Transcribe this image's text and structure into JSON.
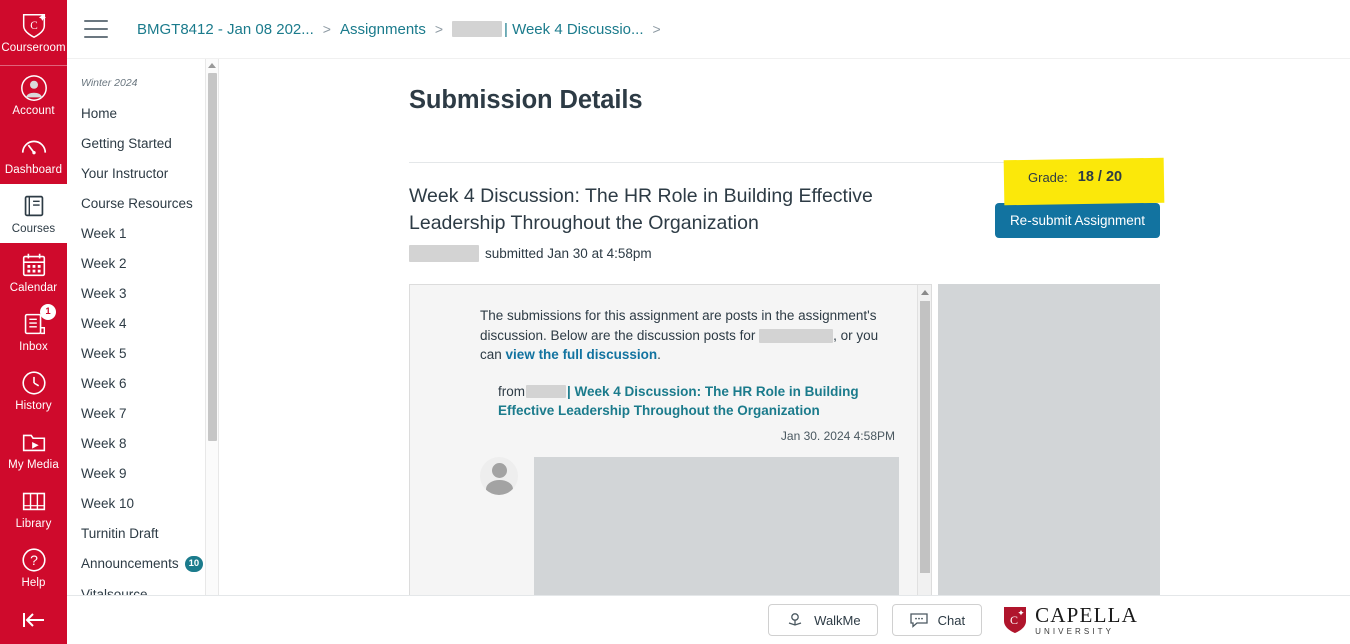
{
  "rail": {
    "brand": {
      "label": "Courseroom",
      "icon": "capella-shield-icon"
    },
    "items": [
      {
        "label": "Account",
        "icon": "account-avatar-icon",
        "active": false,
        "badge": null
      },
      {
        "label": "Dashboard",
        "icon": "dashboard-gauge-icon",
        "active": false,
        "badge": null
      },
      {
        "label": "Courses",
        "icon": "courses-book-icon",
        "active": true,
        "badge": null
      },
      {
        "label": "Calendar",
        "icon": "calendar-icon",
        "active": false,
        "badge": null
      },
      {
        "label": "Inbox",
        "icon": "inbox-icon",
        "active": false,
        "badge": "1"
      },
      {
        "label": "History",
        "icon": "history-clock-icon",
        "active": false,
        "badge": null
      },
      {
        "label": "My Media",
        "icon": "my-media-play-folder-icon",
        "active": false,
        "badge": null
      },
      {
        "label": "Library",
        "icon": "library-books-icon",
        "active": false,
        "badge": null
      },
      {
        "label": "Help",
        "icon": "help-question-icon",
        "active": false,
        "badge": null
      }
    ],
    "collapse_icon": "collapse-left-arrow-icon"
  },
  "breadcrumb": {
    "menu_icon": "hamburger-menu-icon",
    "items": [
      {
        "label": "BMGT8412 - Jan 08 202...",
        "type": "link"
      },
      {
        "label": "Assignments",
        "type": "link"
      },
      {
        "label": "| Week 4 Discussio...",
        "type": "link",
        "redacted_prefix": true
      }
    ],
    "separator": ">"
  },
  "course_nav": {
    "term": "Winter 2024",
    "items": [
      {
        "label": "Home",
        "badge": null
      },
      {
        "label": "Getting Started",
        "badge": null
      },
      {
        "label": "Your Instructor",
        "badge": null
      },
      {
        "label": "Course Resources",
        "badge": null
      },
      {
        "label": "Week 1",
        "badge": null
      },
      {
        "label": "Week 2",
        "badge": null
      },
      {
        "label": "Week 3",
        "badge": null
      },
      {
        "label": "Week 4",
        "badge": null
      },
      {
        "label": "Week 5",
        "badge": null
      },
      {
        "label": "Week 6",
        "badge": null
      },
      {
        "label": "Week 7",
        "badge": null
      },
      {
        "label": "Week 8",
        "badge": null
      },
      {
        "label": "Week 9",
        "badge": null
      },
      {
        "label": "Week 10",
        "badge": null
      },
      {
        "label": "Turnitin Draft",
        "badge": null
      },
      {
        "label": "Announcements",
        "badge": "10"
      },
      {
        "label": "Vitalsource",
        "badge": null
      }
    ]
  },
  "main": {
    "page_title": "Submission Details",
    "grade": {
      "label": "Grade:",
      "score": "18 / 20",
      "highlight_color": "#fbe80a"
    },
    "assignment": {
      "title": "Week 4 Discussion: The HR Role in Building Effective Leadership Throughout the Organization",
      "submitted_text": "submitted Jan 30 at 4:58pm",
      "resubmit_button": "Re-submit Assignment"
    },
    "discussion": {
      "intro_part1": "The submissions for this assignment are posts in the assignment's discussion. Below are the discussion posts for",
      "intro_part2": ", or you can",
      "intro_link": "view the full discussion",
      "intro_end": ".",
      "from_label": "from",
      "post_title": "| Week 4 Discussion: The HR Role in Building Effective Leadership Throughout the Organization",
      "post_date": "Jan 30. 2024 4:58PM"
    }
  },
  "bottom_bar": {
    "walkme": {
      "label": "WalkMe",
      "icon": "walkme-icon"
    },
    "chat": {
      "label": "Chat",
      "icon": "chat-bubble-icon"
    },
    "logo": {
      "main": "CAPELLA",
      "sub": "UNIVERSITY",
      "icon": "capella-shield-icon"
    }
  },
  "colors": {
    "brand_red": "#cf0a2c",
    "link_teal": "#1b7b8c",
    "button_blue": "#1273a0",
    "highlight_yellow": "#fbe80a"
  }
}
